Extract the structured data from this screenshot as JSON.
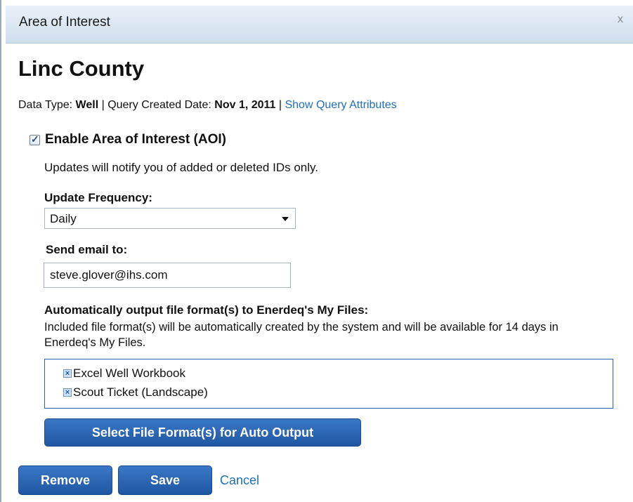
{
  "dialog": {
    "title": "Area of Interest",
    "close_glyph": "x"
  },
  "heading": "Linc County",
  "meta": {
    "data_type_label": "Data Type: ",
    "data_type_value": "Well",
    "sep1": " | ",
    "created_label": "Query Created Date: ",
    "created_value": "Nov 1, 2011",
    "sep2": " | ",
    "show_link": "Show Query Attributes"
  },
  "aoi": {
    "checked": true,
    "label": "Enable Area of Interest (AOI)",
    "notice": "Updates will notify you of added or deleted IDs only."
  },
  "frequency": {
    "label": "Update Frequency:",
    "selected": "Daily"
  },
  "email": {
    "label": "Send email to:",
    "value": "steve.glover@ihs.com"
  },
  "output": {
    "label": "Automatically output file format(s) to Enerdeq's My Files:",
    "description": "Included file format(s) will be automatically created by the system and will be available for 14 days in Enerdeq's My Files.",
    "formats": [
      "Excel Well Workbook",
      "Scout Ticket (Landscape)"
    ],
    "select_button": "Select File Format(s) for Auto Output"
  },
  "actions": {
    "remove": "Remove",
    "save": "Save",
    "cancel": "Cancel"
  },
  "colors": {
    "accent": "#1f56a3",
    "link": "#1f6fbd",
    "titlebar": "#cfdeec"
  }
}
